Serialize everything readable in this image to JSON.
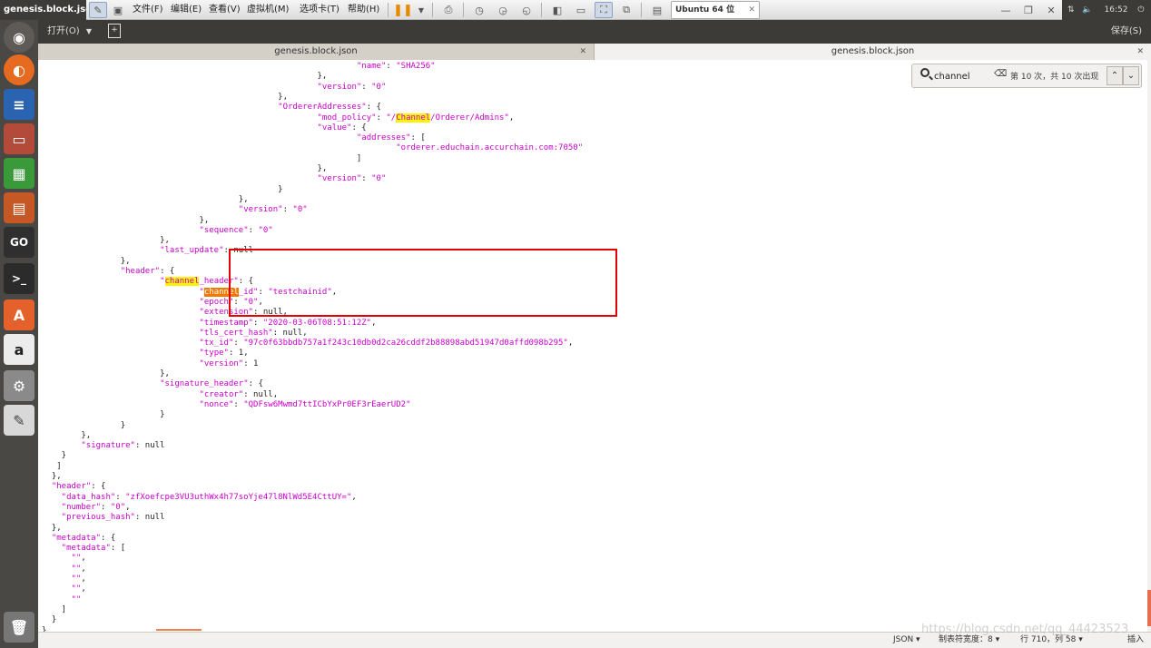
{
  "window": {
    "title": "genesis.block.json ("
  },
  "vm_menu": {
    "file": "文件(F)",
    "edit": "编辑(E)",
    "view": "查看(V)",
    "vm": "虚拟机(M)",
    "tabs": "选项卡(T)",
    "help": "帮助(H)"
  },
  "vm_tab": {
    "label": "Ubuntu 64 位"
  },
  "system": {
    "clock": "16:52"
  },
  "gedit": {
    "open_label": "打开(O)",
    "save_label": "保存(S)"
  },
  "tabs": [
    {
      "label": "genesis.block.json"
    },
    {
      "label": "genesis.block.json"
    }
  ],
  "search": {
    "value": "channel",
    "match_count": "第 10 次，共 10 次出现"
  },
  "status": {
    "language": "JSON",
    "tab_width": "制表符宽度：8",
    "position": "行 710，列 58",
    "mode": "插入"
  },
  "watermark": "https://blog.csdn.net/qq_44423523",
  "editor_lines": [
    {
      "indent": 64,
      "segs": [
        {
          "t": "\"name\"",
          "c": "k"
        },
        {
          "t": ": "
        },
        {
          "t": "\"SHA256\"",
          "c": "k"
        }
      ]
    },
    {
      "indent": 56,
      "segs": [
        {
          "t": "},"
        }
      ]
    },
    {
      "indent": 56,
      "segs": [
        {
          "t": "\"version\"",
          "c": "k"
        },
        {
          "t": ": "
        },
        {
          "t": "\"0\"",
          "c": "k"
        }
      ]
    },
    {
      "indent": 48,
      "segs": [
        {
          "t": "},"
        }
      ]
    },
    {
      "indent": 48,
      "segs": [
        {
          "t": "\"OrdererAddresses\"",
          "c": "k"
        },
        {
          "t": ": {"
        }
      ]
    },
    {
      "indent": 56,
      "segs": [
        {
          "t": "\"mod_policy\"",
          "c": "k"
        },
        {
          "t": ": "
        },
        {
          "t": "\"/",
          "c": "k"
        },
        {
          "t": "Channel",
          "c": "k hl"
        },
        {
          "t": "/Orderer/Admins\"",
          "c": "k"
        },
        {
          "t": ","
        }
      ]
    },
    {
      "indent": 56,
      "segs": [
        {
          "t": "\"value\"",
          "c": "k"
        },
        {
          "t": ": {"
        }
      ]
    },
    {
      "indent": 64,
      "segs": [
        {
          "t": "\"addresses\"",
          "c": "k"
        },
        {
          "t": ": ["
        }
      ]
    },
    {
      "indent": 72,
      "segs": [
        {
          "t": "\"orderer.educhain.accurchain.com:7050\"",
          "c": "k"
        }
      ]
    },
    {
      "indent": 64,
      "segs": [
        {
          "t": "]"
        }
      ]
    },
    {
      "indent": 56,
      "segs": [
        {
          "t": "},"
        }
      ]
    },
    {
      "indent": 56,
      "segs": [
        {
          "t": "\"version\"",
          "c": "k"
        },
        {
          "t": ": "
        },
        {
          "t": "\"0\"",
          "c": "k"
        }
      ]
    },
    {
      "indent": 48,
      "segs": [
        {
          "t": "}"
        }
      ]
    },
    {
      "indent": 40,
      "segs": [
        {
          "t": "},"
        }
      ]
    },
    {
      "indent": 40,
      "segs": [
        {
          "t": "\"version\"",
          "c": "k"
        },
        {
          "t": ": "
        },
        {
          "t": "\"0\"",
          "c": "k"
        }
      ]
    },
    {
      "indent": 32,
      "segs": [
        {
          "t": "},"
        }
      ]
    },
    {
      "indent": 32,
      "segs": [
        {
          "t": "\"sequence\"",
          "c": "k"
        },
        {
          "t": ": "
        },
        {
          "t": "\"0\"",
          "c": "k"
        }
      ]
    },
    {
      "indent": 24,
      "segs": [
        {
          "t": "},"
        }
      ]
    },
    {
      "indent": 24,
      "segs": [
        {
          "t": "\"last_update\"",
          "c": "k"
        },
        {
          "t": ": null"
        }
      ]
    },
    {
      "indent": 16,
      "segs": [
        {
          "t": "},"
        }
      ]
    },
    {
      "indent": 16,
      "segs": [
        {
          "t": "\"header\"",
          "c": "k"
        },
        {
          "t": ": {"
        }
      ]
    },
    {
      "indent": 24,
      "segs": [
        {
          "t": "\"",
          "c": "k"
        },
        {
          "t": "channel",
          "c": "k hl"
        },
        {
          "t": "_header\"",
          "c": "k"
        },
        {
          "t": ": {"
        }
      ]
    },
    {
      "indent": 32,
      "segs": [
        {
          "t": "\"",
          "c": "k"
        },
        {
          "t": "channel",
          "c": "hl-cur"
        },
        {
          "t": "_id\"",
          "c": "k"
        },
        {
          "t": ": "
        },
        {
          "t": "\"testchainid\"",
          "c": "k"
        },
        {
          "t": ","
        }
      ]
    },
    {
      "indent": 32,
      "segs": [
        {
          "t": "\"epoch\"",
          "c": "k"
        },
        {
          "t": ": "
        },
        {
          "t": "\"0\"",
          "c": "k"
        },
        {
          "t": ","
        }
      ]
    },
    {
      "indent": 32,
      "segs": [
        {
          "t": "\"extension\"",
          "c": "k"
        },
        {
          "t": ": null,"
        }
      ]
    },
    {
      "indent": 32,
      "segs": [
        {
          "t": "\"timestamp\"",
          "c": "k"
        },
        {
          "t": ": "
        },
        {
          "t": "\"2020-03-06T08:51:12Z\"",
          "c": "k"
        },
        {
          "t": ","
        }
      ]
    },
    {
      "indent": 32,
      "segs": [
        {
          "t": "\"tls_cert_hash\"",
          "c": "k"
        },
        {
          "t": ": null,"
        }
      ]
    },
    {
      "indent": 32,
      "segs": [
        {
          "t": "\"tx_id\"",
          "c": "k"
        },
        {
          "t": ": "
        },
        {
          "t": "\"97c0f63bbdb757a1f243c10db0d2ca26cddf2b88898abd51947d0affd098b295\"",
          "c": "k"
        },
        {
          "t": ","
        }
      ]
    },
    {
      "indent": 32,
      "segs": [
        {
          "t": "\"type\"",
          "c": "k"
        },
        {
          "t": ": 1,"
        }
      ]
    },
    {
      "indent": 32,
      "segs": [
        {
          "t": "\"version\"",
          "c": "k"
        },
        {
          "t": ": 1"
        }
      ]
    },
    {
      "indent": 24,
      "segs": [
        {
          "t": "},"
        }
      ]
    },
    {
      "indent": 24,
      "segs": [
        {
          "t": "\"signature_header\"",
          "c": "k"
        },
        {
          "t": ": {"
        }
      ]
    },
    {
      "indent": 32,
      "segs": [
        {
          "t": "\"creator\"",
          "c": "k"
        },
        {
          "t": ": null,"
        }
      ]
    },
    {
      "indent": 32,
      "segs": [
        {
          "t": "\"nonce\"",
          "c": "k"
        },
        {
          "t": ": "
        },
        {
          "t": "\"QDFsw6Mwmd7ttICbYxPr0EF3rEaerUD2\"",
          "c": "k"
        }
      ]
    },
    {
      "indent": 24,
      "segs": [
        {
          "t": "}"
        }
      ]
    },
    {
      "indent": 16,
      "segs": [
        {
          "t": "}"
        }
      ]
    },
    {
      "indent": 8,
      "segs": [
        {
          "t": "},"
        }
      ]
    },
    {
      "indent": 8,
      "segs": [
        {
          "t": "\"signature\"",
          "c": "k"
        },
        {
          "t": ": null"
        }
      ]
    },
    {
      "indent": 4,
      "segs": [
        {
          "t": "}"
        }
      ]
    },
    {
      "indent": 3,
      "segs": [
        {
          "t": "]"
        }
      ]
    },
    {
      "indent": 2,
      "segs": [
        {
          "t": "},"
        }
      ]
    },
    {
      "indent": 2,
      "segs": [
        {
          "t": "\"header\"",
          "c": "k"
        },
        {
          "t": ": {"
        }
      ]
    },
    {
      "indent": 4,
      "segs": [
        {
          "t": "\"data_hash\"",
          "c": "k"
        },
        {
          "t": ": "
        },
        {
          "t": "\"zfXoefcpe3VU3uthWx4h77soYje47l8NlWd5E4CttUY=\"",
          "c": "k"
        },
        {
          "t": ","
        }
      ]
    },
    {
      "indent": 4,
      "segs": [
        {
          "t": "\"number\"",
          "c": "k"
        },
        {
          "t": ": "
        },
        {
          "t": "\"0\"",
          "c": "k"
        },
        {
          "t": ","
        }
      ]
    },
    {
      "indent": 4,
      "segs": [
        {
          "t": "\"previous_hash\"",
          "c": "k"
        },
        {
          "t": ": null"
        }
      ]
    },
    {
      "indent": 2,
      "segs": [
        {
          "t": "},"
        }
      ]
    },
    {
      "indent": 2,
      "segs": [
        {
          "t": "\"metadata\"",
          "c": "k"
        },
        {
          "t": ": {"
        }
      ]
    },
    {
      "indent": 4,
      "segs": [
        {
          "t": "\"metadata\"",
          "c": "k"
        },
        {
          "t": ": ["
        }
      ]
    },
    {
      "indent": 6,
      "segs": [
        {
          "t": "\"\"",
          "c": "k"
        },
        {
          "t": ","
        }
      ]
    },
    {
      "indent": 6,
      "segs": [
        {
          "t": "\"\"",
          "c": "k"
        },
        {
          "t": ","
        }
      ]
    },
    {
      "indent": 6,
      "segs": [
        {
          "t": "\"\"",
          "c": "k"
        },
        {
          "t": ","
        }
      ]
    },
    {
      "indent": 6,
      "segs": [
        {
          "t": "\"\"",
          "c": "k"
        },
        {
          "t": ","
        }
      ]
    },
    {
      "indent": 6,
      "segs": [
        {
          "t": "\"\"",
          "c": "k"
        }
      ]
    },
    {
      "indent": 4,
      "segs": [
        {
          "t": "]"
        }
      ]
    },
    {
      "indent": 2,
      "segs": [
        {
          "t": "}"
        }
      ]
    },
    {
      "indent": 0,
      "segs": [
        {
          "t": "}"
        }
      ]
    }
  ]
}
